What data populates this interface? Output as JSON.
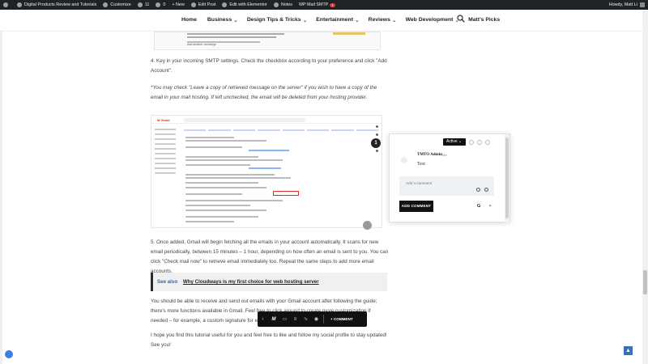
{
  "admin_bar": {
    "site_name": "Digital Products Review and Tutorials",
    "customize": "Customize",
    "updates_count": "11",
    "comments_count": "0",
    "new_label": "+ New",
    "edit_post": "Edit Post",
    "edit_elementor": "Edit with Elementor",
    "notes": "Notes",
    "wp_mail_smtp": "WP Mail SMTP",
    "smtp_badge": "1",
    "howdy": "Howdy, Matt Li"
  },
  "nav": {
    "items": [
      "Home",
      "Business",
      "Design Tips & Tricks",
      "Entertainment",
      "Reviews",
      "Web Development",
      "Matt's Picks"
    ],
    "carets": [
      "",
      "⌄",
      "⌄",
      "⌄",
      "⌄",
      "⌄",
      ""
    ]
  },
  "embedded_screenshot_top": {
    "label": "Add another exchange"
  },
  "article": {
    "step4": "4. Key in your incoming SMTP settings. Check the checkbox according to your preference and click \"Add Account\".",
    "note": "*You may check \"Leave a copy of retrieved message on the server\" if you wish to have a copy of the email in your mail hosting. If left unchecked, the email will be deleted from your hosting provider.",
    "step5": "5. Once added, Gmail will begin fetching all the emails in your account automatically.  It scans for new email periodically, between 15 minutes – 1 hour, depending on how often an email is sent to you. You can click \"Check mail now\" to retrieve email immediately too. Repeat the same steps to add more email accounts.",
    "see_also_label": "See also",
    "see_also_link": "Why Cloudways is my first choice for web hosting server",
    "para_after": "You should be able to receive and send out emails with your Gmail account after following the guide; there's more functions available in Gmail. Feel free to click around to create more customization if needed – for example, a custom signature for each email address.",
    "closing": "I hope you find this tutorial useful for you and feel free to like and follow my social profile to stay updated! See you!"
  },
  "gmail_screenshot": {
    "logo": "M Gmail"
  },
  "comment_panel": {
    "marker_number": "1",
    "status": "Active ⌄",
    "author": "TMTO Admin",
    "time": "10m",
    "comment_text": "Test",
    "input_placeholder": "Add a comment",
    "add_button": "ADD COMMENT",
    "g_label": "G"
  },
  "bottom_toolbar": {
    "logo": "M",
    "add_comment": "+ COMMENT"
  },
  "colors": {
    "admin_bar_bg": "#1d2327",
    "accent_blue": "#2b6cb0",
    "badge_red": "#d63638"
  }
}
